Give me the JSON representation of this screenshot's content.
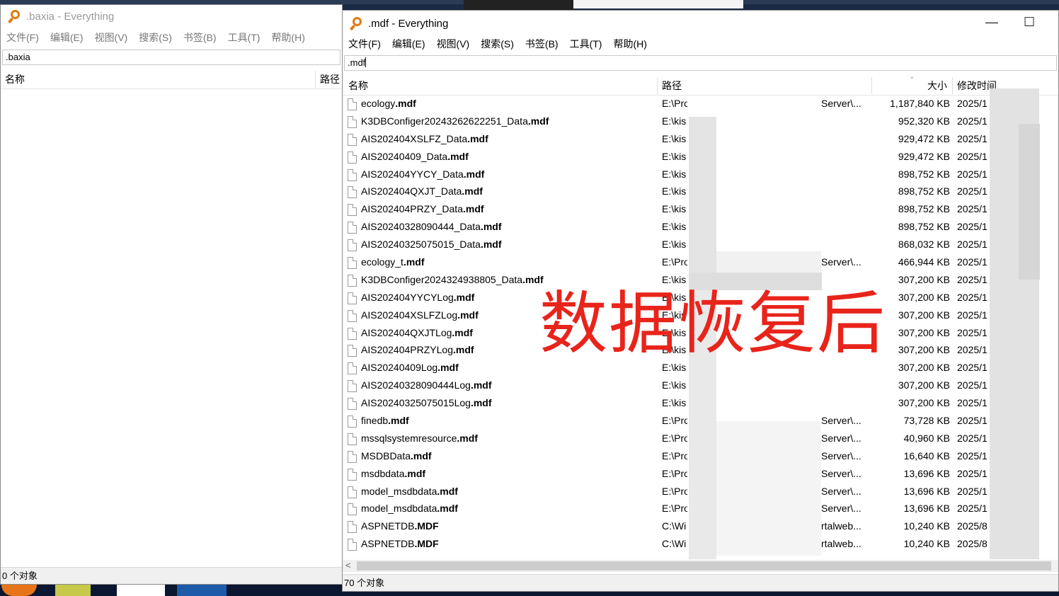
{
  "left_window": {
    "title": ".baxia - Everything",
    "menu": [
      "文件(F)",
      "编辑(E)",
      "视图(V)",
      "搜索(S)",
      "书签(B)",
      "工具(T)",
      "帮助(H)"
    ],
    "search_value": ".baxia",
    "columns": {
      "name": "名称",
      "path": "路径"
    },
    "status": "0 个对象"
  },
  "right_window": {
    "title": ".mdf - Everything",
    "menu": [
      "文件(F)",
      "编辑(E)",
      "视图(V)",
      "搜索(S)",
      "书签(B)",
      "工具(T)",
      "帮助(H)"
    ],
    "search_value": ".mdf",
    "columns": {
      "name": "名称",
      "path": "路径",
      "size": "大小",
      "modified": "修改时间"
    },
    "status": "70 个对象",
    "rows": [
      {
        "pre": "ecology",
        "ext": ".mdf",
        "path": "E:\\Pro",
        "path2": "Server\\...",
        "size": "1,187,840 KB",
        "date": "2025/1"
      },
      {
        "pre": "K3DBConfiger20243262622251_Data",
        "ext": ".mdf",
        "path": "E:\\kis",
        "path2": "",
        "size": "952,320 KB",
        "date": "2025/1"
      },
      {
        "pre": "AIS202404XSLFZ_Data",
        "ext": ".mdf",
        "path": "E:\\kis",
        "path2": "",
        "size": "929,472 KB",
        "date": "2025/1"
      },
      {
        "pre": "AIS20240409_Data",
        "ext": ".mdf",
        "path": "E:\\kis",
        "path2": "",
        "size": "929,472 KB",
        "date": "2025/1"
      },
      {
        "pre": "AIS202404YYCY_Data",
        "ext": ".mdf",
        "path": "E:\\kis",
        "path2": "",
        "size": "898,752 KB",
        "date": "2025/1"
      },
      {
        "pre": "AIS202404QXJT_Data",
        "ext": ".mdf",
        "path": "E:\\kis",
        "path2": "",
        "size": "898,752 KB",
        "date": "2025/1"
      },
      {
        "pre": "AIS202404PRZY_Data",
        "ext": ".mdf",
        "path": "E:\\kis",
        "path2": "",
        "size": "898,752 KB",
        "date": "2025/1"
      },
      {
        "pre": "AIS20240328090444_Data",
        "ext": ".mdf",
        "path": "E:\\kis",
        "path2": "",
        "size": "898,752 KB",
        "date": "2025/1"
      },
      {
        "pre": "AIS20240325075015_Data",
        "ext": ".mdf",
        "path": "E:\\kis",
        "path2": "",
        "size": "868,032 KB",
        "date": "2025/1"
      },
      {
        "pre": "ecology_t",
        "ext": ".mdf",
        "path": "E:\\Pro",
        "path2": "Server\\...",
        "size": "466,944 KB",
        "date": "2025/1"
      },
      {
        "pre": "K3DBConfiger2024324938805_Data",
        "ext": ".mdf",
        "path": "E:\\kis",
        "path2": "",
        "size": "307,200 KB",
        "date": "2025/1"
      },
      {
        "pre": "AIS202404YYCYLog",
        "ext": ".mdf",
        "path": "E:\\kis",
        "path2": "",
        "size": "307,200 KB",
        "date": "2025/1"
      },
      {
        "pre": "AIS202404XSLFZLog",
        "ext": ".mdf",
        "path": "E:\\kis",
        "path2": "",
        "size": "307,200 KB",
        "date": "2025/1"
      },
      {
        "pre": "AIS202404QXJTLog",
        "ext": ".mdf",
        "path": "E:\\kis",
        "path2": "",
        "size": "307,200 KB",
        "date": "2025/1"
      },
      {
        "pre": "AIS202404PRZYLog",
        "ext": ".mdf",
        "path": "E:\\kis",
        "path2": "",
        "size": "307,200 KB",
        "date": "2025/1"
      },
      {
        "pre": "AIS20240409Log",
        "ext": ".mdf",
        "path": "E:\\kis",
        "path2": "",
        "size": "307,200 KB",
        "date": "2025/1"
      },
      {
        "pre": "AIS20240328090444Log",
        "ext": ".mdf",
        "path": "E:\\kis",
        "path2": "",
        "size": "307,200 KB",
        "date": "2025/1"
      },
      {
        "pre": "AIS20240325075015Log",
        "ext": ".mdf",
        "path": "E:\\kis",
        "path2": "",
        "size": "307,200 KB",
        "date": "2025/1"
      },
      {
        "pre": "finedb",
        "ext": ".mdf",
        "path": "E:\\Pro",
        "path2": "Server\\...",
        "size": "73,728 KB",
        "date": "2025/1"
      },
      {
        "pre": "mssqlsystemresource",
        "ext": ".mdf",
        "path": "E:\\Pro",
        "path2": "Server\\...",
        "size": "40,960 KB",
        "date": "2025/1"
      },
      {
        "pre": "MSDBData",
        "ext": ".mdf",
        "path": "E:\\Pro",
        "path2": "Server\\...",
        "size": "16,640 KB",
        "date": "2025/1"
      },
      {
        "pre": "msdbdata",
        "ext": ".mdf",
        "path": "E:\\Pro",
        "path2": "Server\\...",
        "size": "13,696 KB",
        "date": "2025/1"
      },
      {
        "pre": "model_msdbdata",
        "ext": ".mdf",
        "path": "E:\\Pro",
        "path2": "Server\\...",
        "size": "13,696 KB",
        "date": "2025/1"
      },
      {
        "pre": "model_msdbdata",
        "ext": ".mdf",
        "path": "E:\\Pro",
        "path2": "Server\\...",
        "size": "13,696 KB",
        "date": "2025/1"
      },
      {
        "pre": "ASPNETDB",
        "ext": ".MDF",
        "path": "C:\\Wi",
        "path2": "rtalweb...",
        "size": "10,240 KB",
        "date": "2025/8"
      },
      {
        "pre": "ASPNETDB",
        "ext": ".MDF",
        "path": "C:\\Wi",
        "path2": "rtalweb...",
        "size": "10,240 KB",
        "date": "2025/8"
      }
    ]
  },
  "overlay_text": "数据恢复后"
}
